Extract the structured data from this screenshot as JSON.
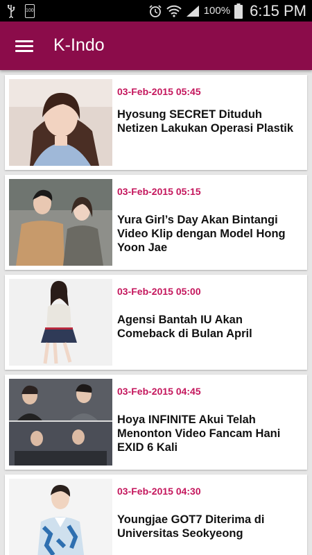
{
  "status_bar": {
    "left_icons": [
      "usb-icon",
      "sd-card-icon",
      "battery-100-icon"
    ],
    "battery_chip_text": "100",
    "battery_percent": "100%",
    "time": "6:15 PM"
  },
  "app_bar": {
    "title": "K-Indo",
    "background": "#8b0c4a",
    "menu_icon": "hamburger-menu-icon"
  },
  "colors": {
    "accent_date": "#c4165c",
    "card_bg": "#ffffff",
    "list_bg": "#e6e6e6"
  },
  "articles": [
    {
      "date": "03-Feb-2015 05:45",
      "title": "Hyosung SECRET Dituduh Netizen Lakukan Operasi Plastik"
    },
    {
      "date": "03-Feb-2015 05:15",
      "title": "Yura Girl’s Day Akan Bintangi Video Klip dengan Model Hong Yoon Jae"
    },
    {
      "date": "03-Feb-2015 05:00",
      "title": "Agensi Bantah IU Akan Comeback di Bulan April"
    },
    {
      "date": "03-Feb-2015 04:45",
      "title": "Hoya INFINITE Akui Telah Menonton Video Fancam Hani EXID 6 Kali"
    },
    {
      "date": "03-Feb-2015 04:30",
      "title": "Youngjae GOT7 Diterima di Universitas Seokyeong"
    }
  ]
}
